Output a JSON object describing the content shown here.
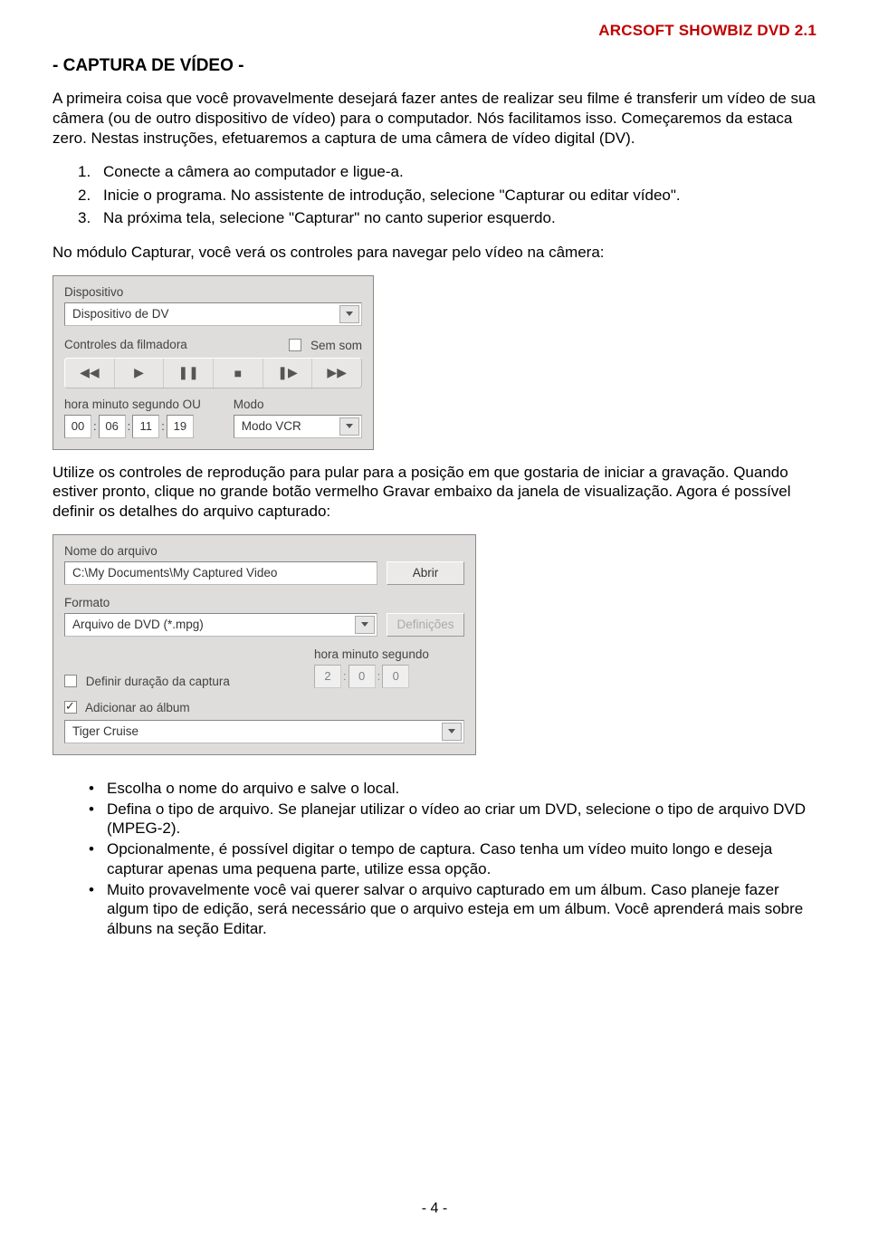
{
  "header": {
    "product": "ARCSOFT SHOWBIZ DVD 2.1"
  },
  "section_title": "- CAPTURA DE VÍDEO -",
  "intro": "A primeira coisa que você provavelmente desejará fazer antes de realizar seu filme é transferir um vídeo de sua câmera (ou de outro dispositivo de vídeo) para o computador. Nós facilitamos isso. Começaremos da estaca zero. Nestas instruções, efetuaremos a captura de uma câmera de vídeo digital (DV).",
  "steps": [
    {
      "n": "1.",
      "t": "Conecte a câmera ao computador e ligue-a."
    },
    {
      "n": "2.",
      "t": "Inicie o programa. No assistente de introdução, selecione \"Capturar ou editar vídeo\"."
    },
    {
      "n": "3.",
      "t": "Na próxima tela, selecione \"Capturar\" no canto superior esquerdo."
    }
  ],
  "p_after_steps": "No módulo Capturar, você verá os controles para navegar pelo vídeo na câmera:",
  "panel1": {
    "device_label": "Dispositivo",
    "device_value": "Dispositivo de DV",
    "controls_label": "Controles da filmadora",
    "mute_label": "Sem som",
    "time_label": "hora minuto segundo OU",
    "time": {
      "h": "00",
      "m": "06",
      "s": "11",
      "f": "19"
    },
    "mode_label": "Modo",
    "mode_value": "Modo VCR"
  },
  "p_mid": "Utilize os controles de reprodução para pular para a posição em que gostaria de iniciar a gravação. Quando estiver pronto, clique no grande botão vermelho Gravar embaixo da janela de visualização. Agora é possível definir os detalhes do arquivo capturado:",
  "panel2": {
    "filename_label": "Nome do arquivo",
    "filename_value": "C:\\My Documents\\My Captured Video",
    "open_btn": "Abrir",
    "format_label": "Formato",
    "format_value": "Arquivo de DVD (*.mpg)",
    "defs_btn": "Definições",
    "duration_chk": "Definir duração da captura",
    "hms_label": "hora minuto segundo",
    "hms": {
      "h": "2",
      "m": "0",
      "s": "0"
    },
    "album_chk": "Adicionar ao álbum",
    "album_value": "Tiger Cruise"
  },
  "bullets": [
    "Escolha o nome do arquivo e salve o local.",
    "Defina o tipo de arquivo. Se planejar utilizar o vídeo ao criar um DVD, selecione o tipo de arquivo DVD (MPEG-2).",
    "Opcionalmente, é possível digitar o tempo de captura. Caso tenha um vídeo muito longo e deseja capturar apenas uma pequena parte, utilize essa opção.",
    "Muito provavelmente você vai querer salvar o arquivo capturado em um álbum. Caso planeje fazer algum tipo de edição, será necessário que o arquivo esteja em um álbum. Você aprenderá mais sobre álbuns na seção Editar."
  ],
  "footer": "- 4 -"
}
